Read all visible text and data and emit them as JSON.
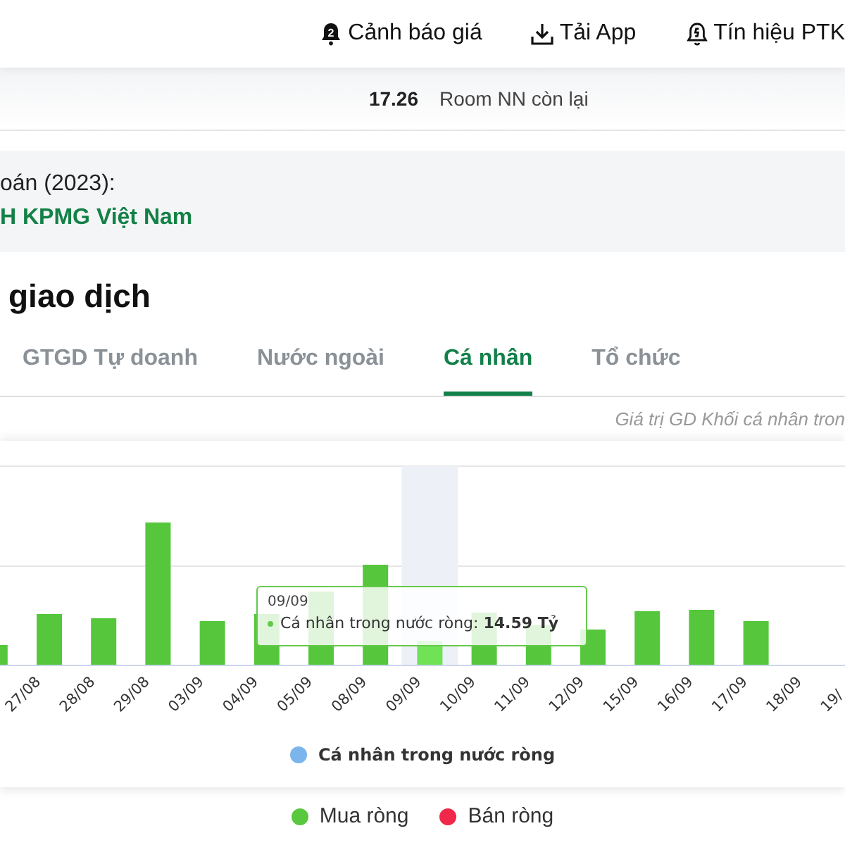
{
  "header": {
    "actions": [
      {
        "kind": "bell",
        "badge": "2",
        "label": "Cảnh báo giá"
      },
      {
        "kind": "download",
        "label": "Tải App"
      },
      {
        "kind": "signal",
        "label": "Tín hiệu PTK"
      }
    ]
  },
  "stat": {
    "value": "17.26",
    "label": "Room NN còn lại"
  },
  "auditor": {
    "label": "oán (2023):",
    "value": "H KPMG Việt Nam"
  },
  "section_title": "giao dịch",
  "tabs": [
    {
      "label": "GTGD Tự doanh",
      "selected": false
    },
    {
      "label": "Nước ngoài",
      "selected": false
    },
    {
      "label": "Cá nhân",
      "selected": true
    },
    {
      "label": "Tổ chức",
      "selected": false
    }
  ],
  "chart_note": "Giá trị GD Khối cá nhân tron",
  "chart": {
    "categories": [
      {
        "label": "27/08",
        "highlighted": false
      },
      {
        "label": "28/08",
        "highlighted": false
      },
      {
        "label": "29/08",
        "highlighted": false
      },
      {
        "label": "03/09",
        "highlighted": false
      },
      {
        "label": "04/09",
        "highlighted": false
      },
      {
        "label": "05/09",
        "highlighted": false
      },
      {
        "label": "08/09",
        "highlighted": false
      },
      {
        "label": "09/09",
        "highlighted": true
      },
      {
        "label": "10/09",
        "highlighted": false
      },
      {
        "label": "11/09",
        "highlighted": false
      },
      {
        "label": "12/09",
        "highlighted": false
      },
      {
        "label": "15/09",
        "highlighted": false
      },
      {
        "label": "16/09",
        "highlighted": false
      },
      {
        "label": "17/09",
        "highlighted": false
      },
      {
        "label": "18/09",
        "highlighted": false
      },
      {
        "label": "19/",
        "highlighted": false
      }
    ],
    "tooltip": {
      "title": "09/09",
      "text": "Cá nhân trong nước ròng: **14.59 Tỷ**"
    },
    "series_legend": {
      "label": "Cá nhân trong nước ròng",
      "color": "#7cb5ec"
    }
  },
  "legend": [
    {
      "label": "Mua ròng",
      "color": "#5ac83f"
    },
    {
      "label": "Bán ròng",
      "color": "#f0284a"
    }
  ]
}
